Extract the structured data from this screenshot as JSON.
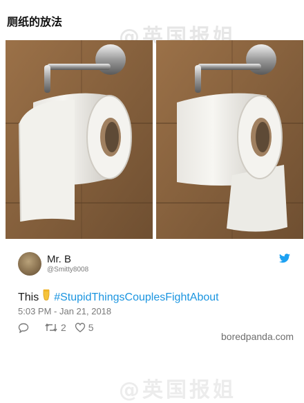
{
  "page": {
    "title": "厕纸的放法",
    "watermark": "@英国报姐"
  },
  "tweet": {
    "name": "Mr. B",
    "handle": "@Smitty8008",
    "text_prefix": "This",
    "hashtag": "#StupidThingsCouplesFightAbout",
    "timestamp": "5:03 PM - Jan 21, 2018",
    "retweets": "2",
    "likes": "5"
  },
  "credit": "boredpanda.com",
  "icons": {
    "twitter": "twitter-bird-icon",
    "reply": "reply-icon",
    "retweet": "retweet-icon",
    "like": "heart-icon",
    "emoji": "backhand-index-pointing-down-emoji"
  },
  "colors": {
    "hashtag": "#1b95e0",
    "twitter": "#1da1f2",
    "wall": "#8a6540"
  }
}
